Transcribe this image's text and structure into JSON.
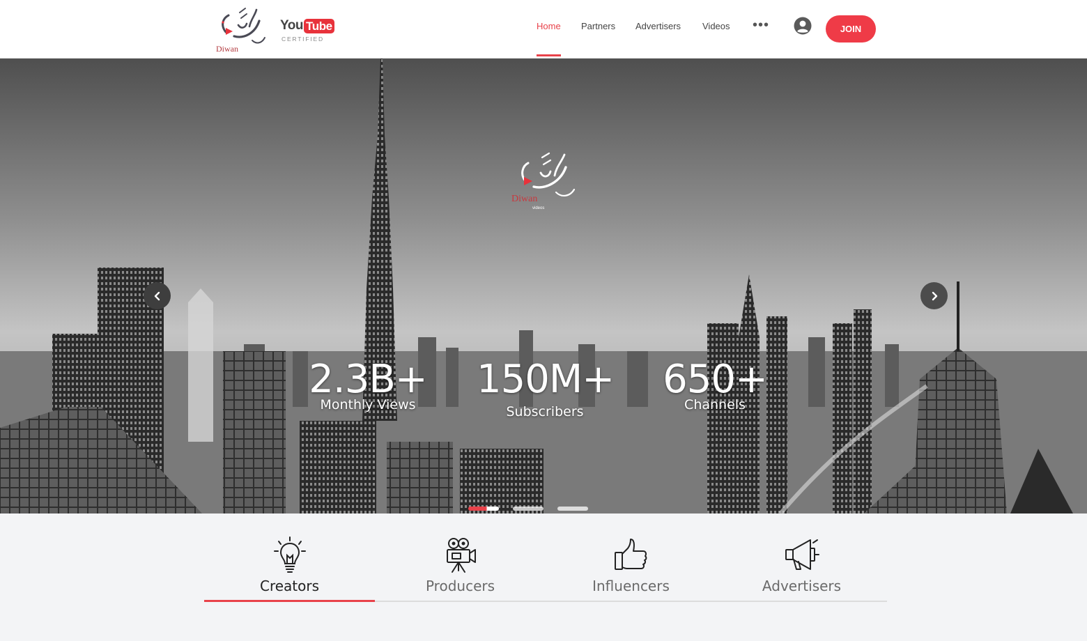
{
  "brand": {
    "logo_text": "Diwan",
    "logo_subtext": "videos",
    "badge_you": "You",
    "badge_tube": "Tube",
    "badge_certified": "CERTIFIED"
  },
  "nav": {
    "items": [
      {
        "label": "Home",
        "active": true
      },
      {
        "label": "Partners",
        "active": false
      },
      {
        "label": "Advertisers",
        "active": false
      },
      {
        "label": "Videos",
        "active": false
      }
    ],
    "more_icon": "more-horizontal-icon",
    "user_icon": "user-circle-icon",
    "join_label": "JOIN"
  },
  "hero": {
    "stats": [
      {
        "value": "2.3B+",
        "label": "Monthly Views"
      },
      {
        "value": "150M+",
        "label": "Subscribers"
      },
      {
        "value": "650+",
        "label": "Channels"
      }
    ],
    "prev_icon": "chevron-left-icon",
    "next_icon": "chevron-right-icon",
    "slides_count": 3,
    "active_slide": 1
  },
  "tabs": [
    {
      "label": "Creators",
      "icon": "lightbulb-icon",
      "active": true
    },
    {
      "label": "Producers",
      "icon": "movie-camera-icon",
      "active": false
    },
    {
      "label": "Influencers",
      "icon": "thumbs-up-icon",
      "active": false
    },
    {
      "label": "Advertisers",
      "icon": "megaphone-icon",
      "active": false
    }
  ],
  "colors": {
    "accent": "#e8424a",
    "join_button": "#ef3b47",
    "text_dark": "#222222",
    "text_muted": "#6a6a6a",
    "background": "#f3f4f6"
  }
}
